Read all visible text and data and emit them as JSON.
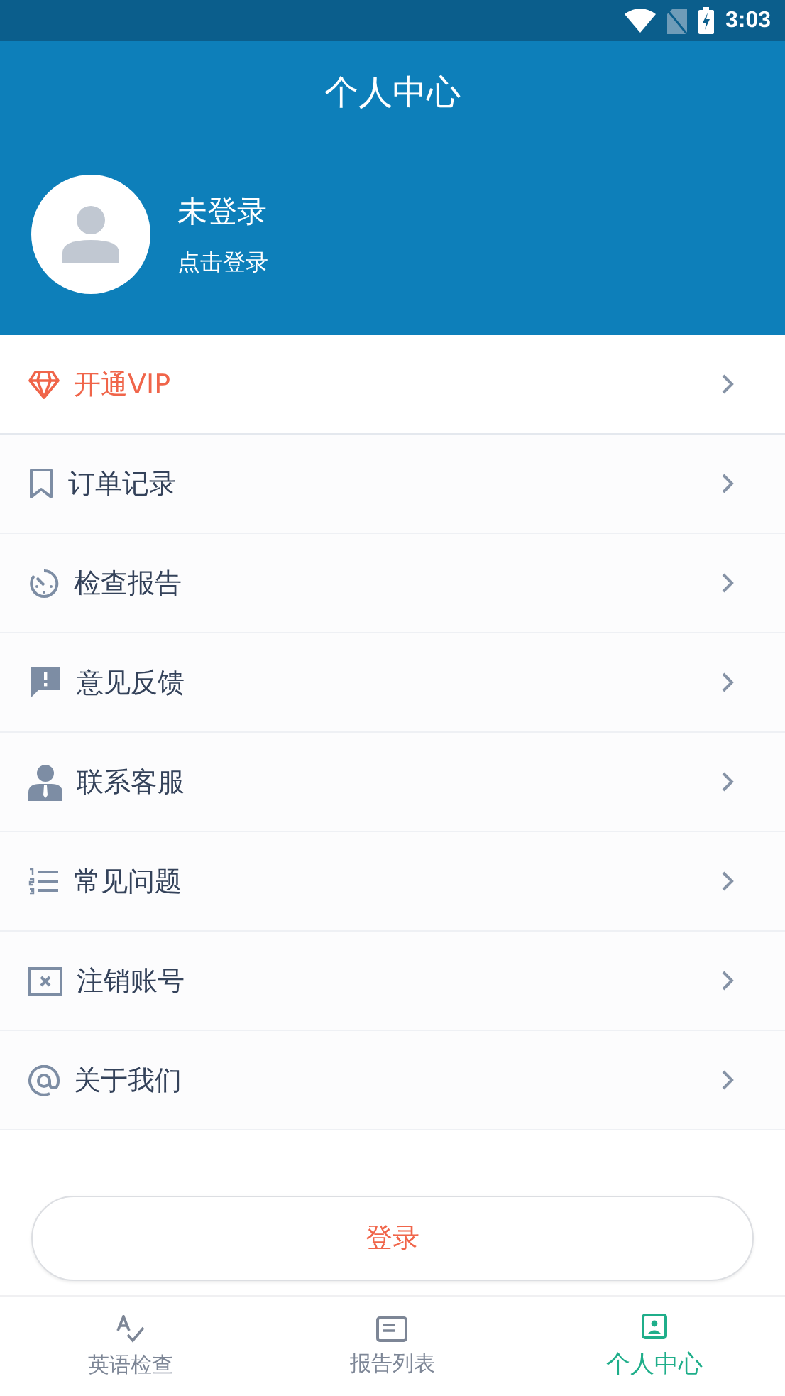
{
  "status_bar": {
    "time": "3:03"
  },
  "header": {
    "title": "个人中心"
  },
  "profile": {
    "name": "未登录",
    "hint": "点击登录"
  },
  "menu": [
    {
      "label": "开通VIP",
      "kind": "vip"
    },
    {
      "label": "订单记录",
      "kind": "normal"
    },
    {
      "label": "检查报告",
      "kind": "normal"
    },
    {
      "label": "意见反馈",
      "kind": "normal"
    },
    {
      "label": "联系客服",
      "kind": "normal"
    },
    {
      "label": "常见问题",
      "kind": "normal"
    },
    {
      "label": "注销账号",
      "kind": "normal"
    },
    {
      "label": "关于我们",
      "kind": "normal"
    }
  ],
  "login_button": "登录",
  "bottom_nav": [
    {
      "label": "英语检查",
      "selected": false
    },
    {
      "label": "报告列表",
      "selected": false
    },
    {
      "label": "个人中心",
      "selected": true
    }
  ]
}
